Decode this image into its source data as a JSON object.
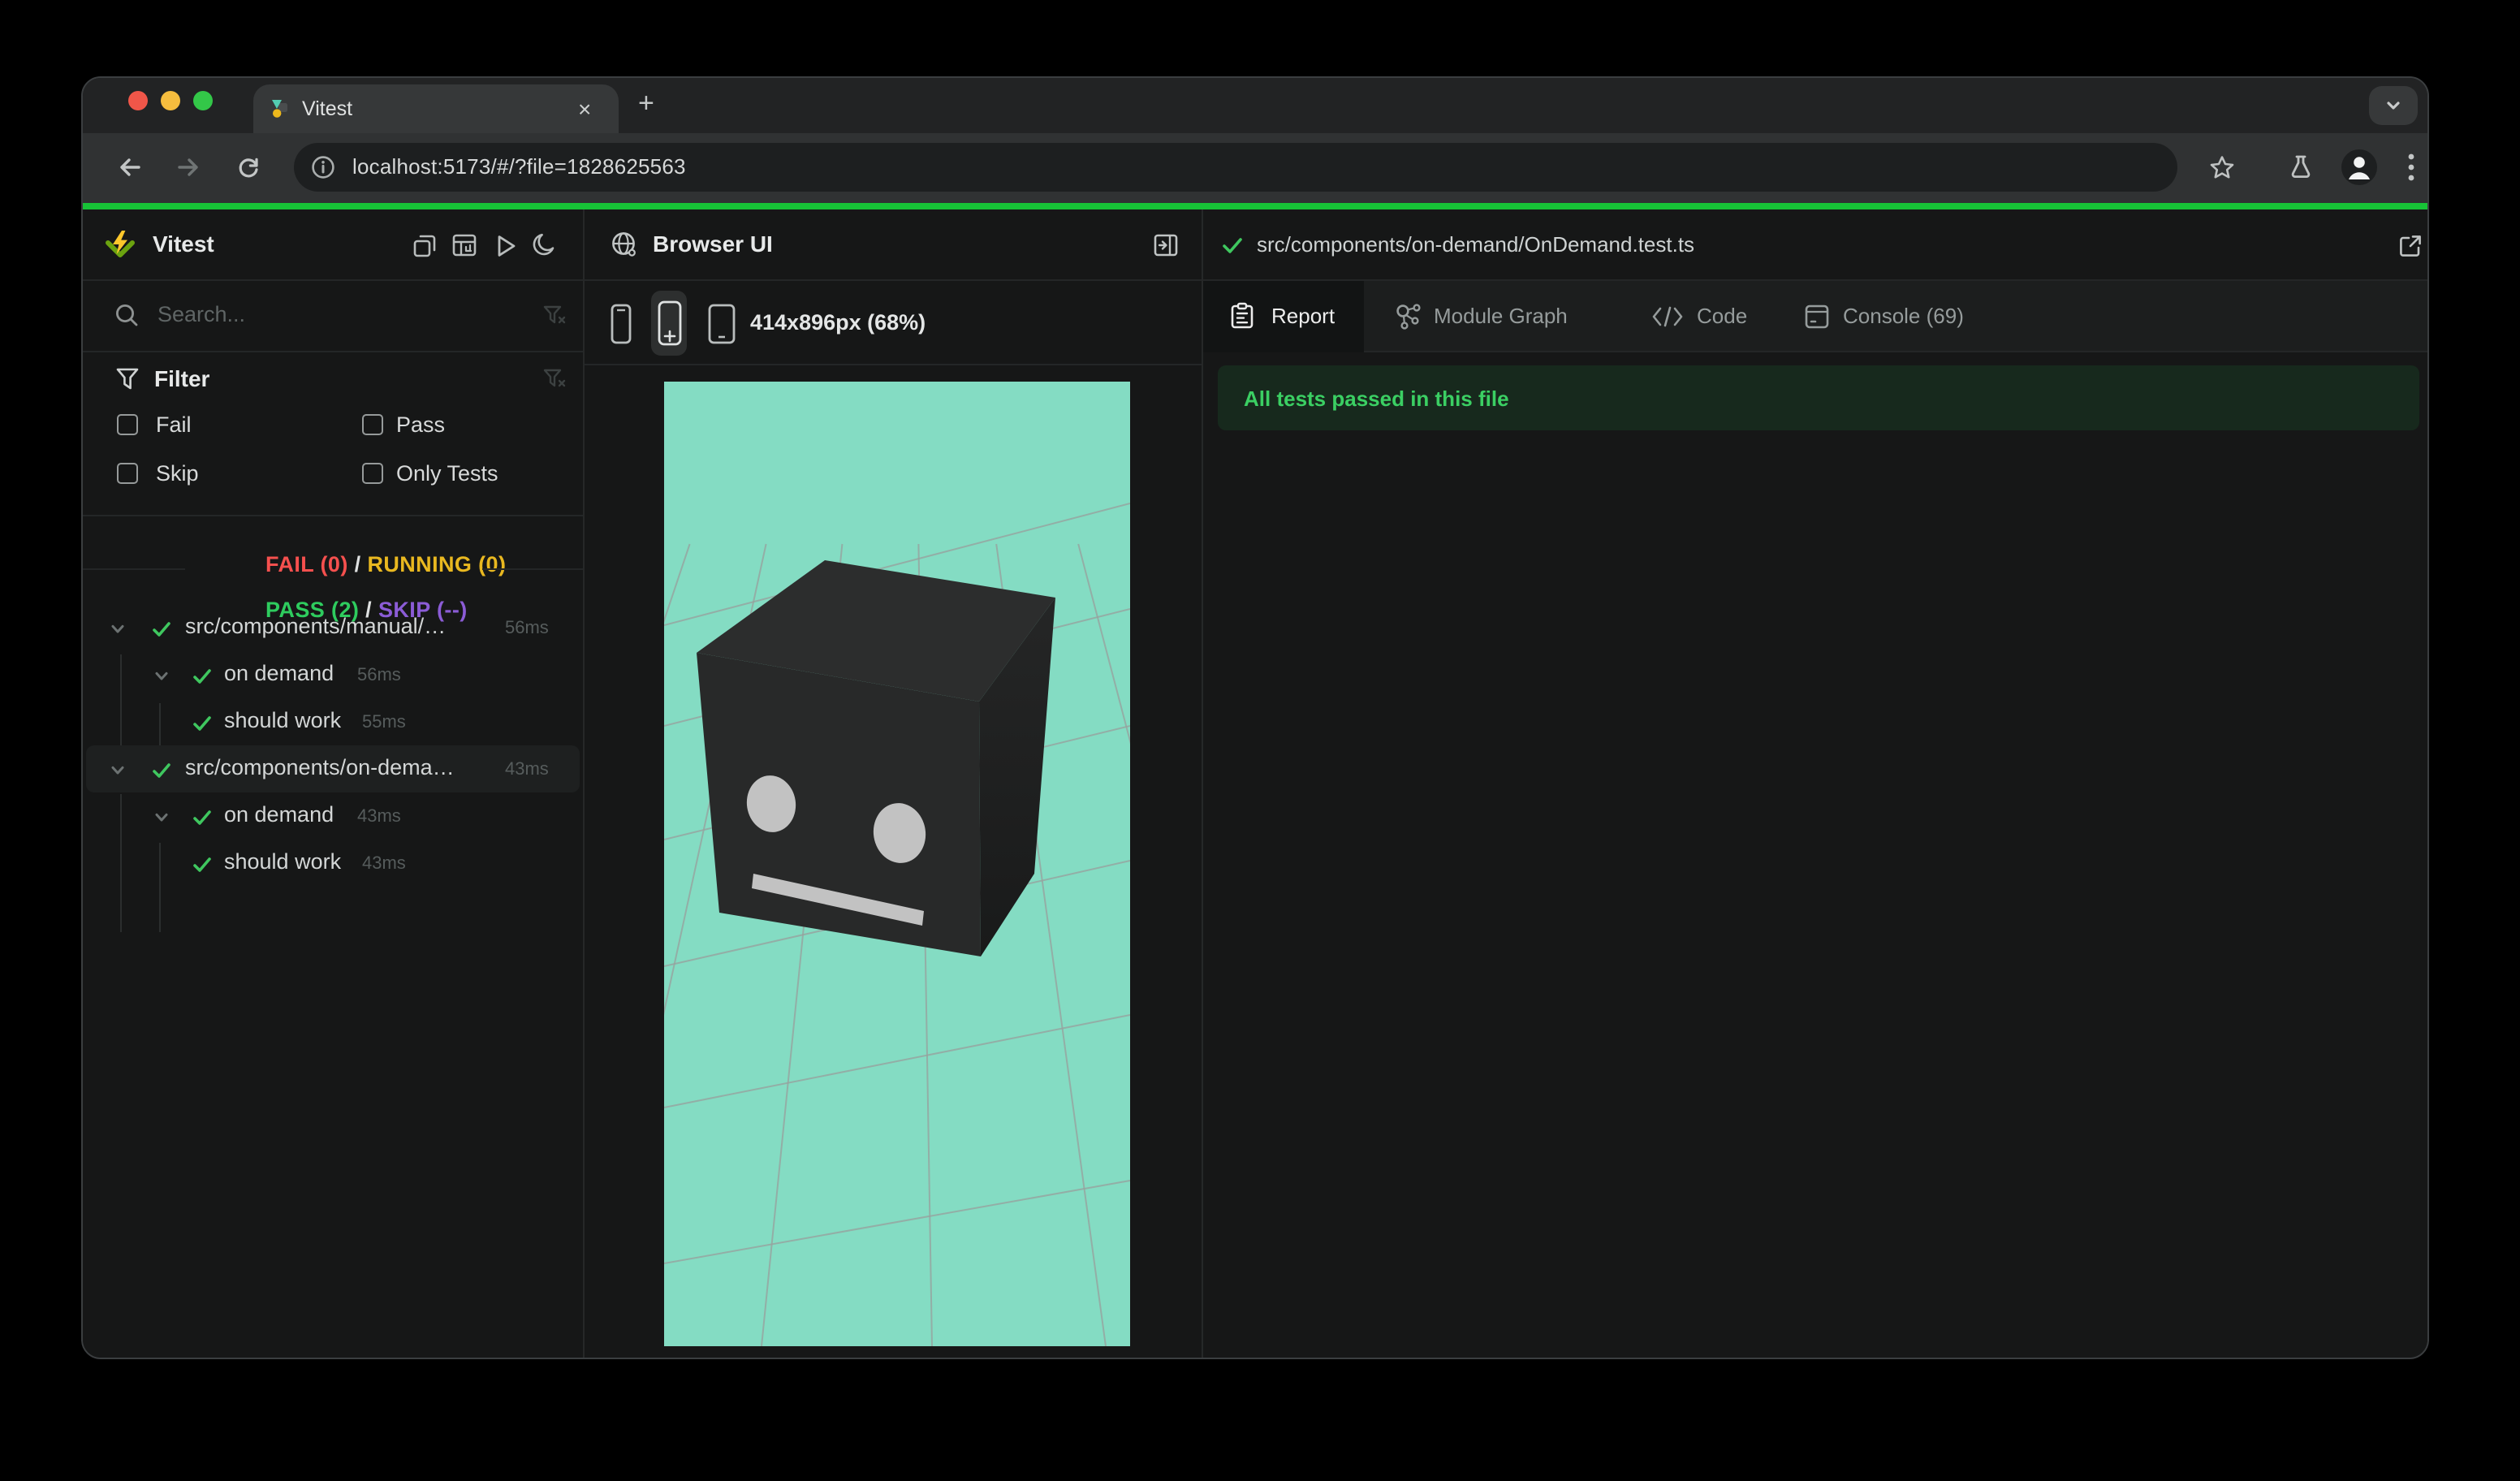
{
  "browser": {
    "tab_title": "Vitest",
    "close_tab_glyph": "×",
    "new_tab_glyph": "+",
    "url": "localhost:5173/#/?file=1828625563",
    "icons": [
      "back-icon",
      "forward-icon",
      "reload-icon",
      "info-icon",
      "star-icon",
      "flask-icon",
      "avatar-icon",
      "kebab-menu-icon",
      "tab-search-chevron-icon",
      "vitest-favicon"
    ]
  },
  "sidebar": {
    "title": "Vitest",
    "header_icons": [
      "windows-icon",
      "dashboard-icon",
      "run-all-icon",
      "dark-mode-icon"
    ],
    "search": {
      "placeholder": "Search..."
    },
    "filter": {
      "title": "Filter",
      "options": [
        "Fail",
        "Pass",
        "Skip",
        "Only Tests"
      ]
    },
    "status": {
      "fail": "FAIL (0)",
      "running": "RUNNING (0)",
      "pass": "PASS (2)",
      "skip": "SKIP (--)",
      "sep": " / "
    },
    "tree": [
      {
        "type": "file",
        "label": "src/components/manual/…",
        "time": "56ms",
        "selected": false
      },
      {
        "type": "suite",
        "label": "on demand",
        "time": "56ms",
        "selected": false
      },
      {
        "type": "test",
        "label": "should work",
        "time": "55ms",
        "selected": false
      },
      {
        "type": "file",
        "label": "src/components/on-dema…",
        "time": "43ms",
        "selected": true
      },
      {
        "type": "suite",
        "label": "on demand",
        "time": "43ms",
        "selected": false
      },
      {
        "type": "test",
        "label": "should work",
        "time": "43ms",
        "selected": false
      }
    ]
  },
  "preview": {
    "title": "Browser UI",
    "dimensions": "414x896px (68%)",
    "device_icons": [
      "phone-small-icon",
      "phone-add-icon",
      "tablet-icon"
    ],
    "viewport_background": "#84dcc3"
  },
  "details": {
    "file_path": "src/components/on-demand/OnDemand.test.ts",
    "tabs": {
      "report": "Report",
      "module_graph": "Module Graph",
      "code": "Code",
      "console": "Console (69)"
    },
    "banner": "All tests passed in this file"
  },
  "colors": {
    "fail": "#f5504e",
    "running": "#e9b820",
    "pass": "#2ecc5e",
    "skip": "#8b5cd6",
    "accent_green": "#17c337",
    "banner_text": "#3bcf63",
    "viewport_teal": "#84dcc3"
  }
}
